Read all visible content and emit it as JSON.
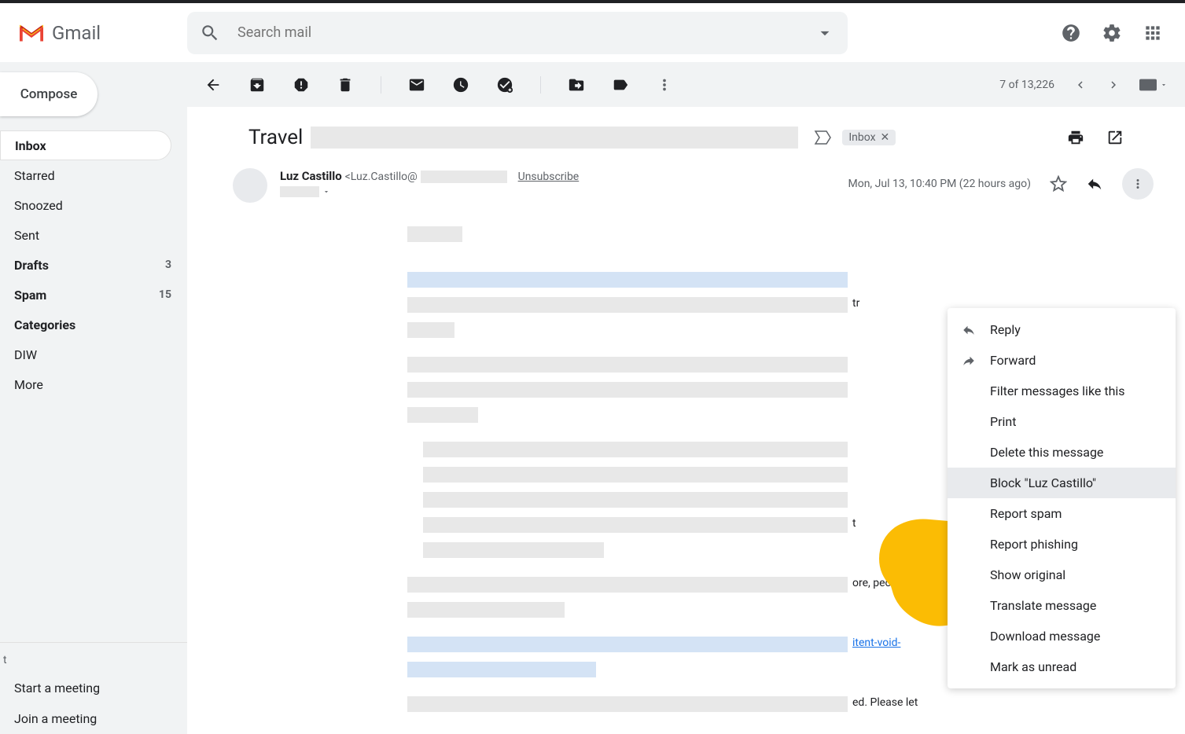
{
  "app": {
    "name": "Gmail",
    "search_placeholder": "Search mail"
  },
  "compose_label": "Compose",
  "sidebar": {
    "items": [
      {
        "label": "Inbox",
        "count": "",
        "active": true,
        "bold": true
      },
      {
        "label": "Starred",
        "count": ""
      },
      {
        "label": "Snoozed",
        "count": ""
      },
      {
        "label": "Sent",
        "count": ""
      },
      {
        "label": "Drafts",
        "count": "3",
        "bold": true
      },
      {
        "label": "Spam",
        "count": "15",
        "bold": true
      },
      {
        "label": "Categories",
        "count": "",
        "bold": true
      },
      {
        "label": "DIW",
        "count": ""
      },
      {
        "label": "More",
        "count": ""
      }
    ]
  },
  "meet": {
    "label": "t",
    "start": "Start a meeting",
    "join": "Join a meeting"
  },
  "toolbar": {
    "position": "7 of 13,226"
  },
  "message": {
    "subject": "Travel",
    "label": "Inbox",
    "sender_name": "Luz Castillo",
    "sender_email": "<Luz.Castillo@",
    "unsubscribe": "Unsubscribe",
    "timestamp": "Mon, Jul 13, 10:40 PM (22 hours ago)",
    "body_link1": "itent-void-",
    "body_text1": "ore, people",
    "body_text2": "ed. Please let"
  },
  "menu": {
    "reply": "Reply",
    "forward": "Forward",
    "filter": "Filter messages like this",
    "print": "Print",
    "delete": "Delete this message",
    "block": "Block \"Luz Castillo\"",
    "report_spam": "Report spam",
    "report_phishing": "Report phishing",
    "show_original": "Show original",
    "translate": "Translate message",
    "download": "Download message",
    "mark_unread": "Mark as unread"
  }
}
